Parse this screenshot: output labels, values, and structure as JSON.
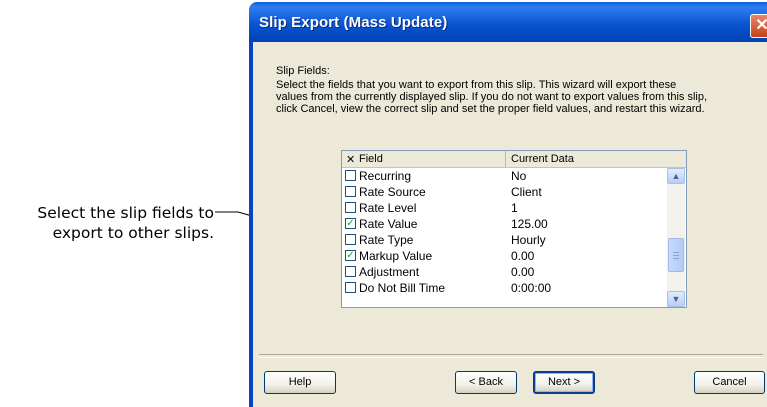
{
  "callout": {
    "line1": "Select the slip fields to",
    "line2": "export to other slips."
  },
  "dialog": {
    "title": "Slip Export (Mass Update)",
    "close_glyph": "✕",
    "heading": "Slip Fields:",
    "description_lines": [
      "Select the fields that you want to export from this slip. This wizard will export these",
      "values from the currently displayed slip. If you do not want to export values from this slip,",
      "click Cancel, view the correct slip and set the proper field values, and restart this wizard."
    ]
  },
  "grid": {
    "columns": {
      "check": "✕",
      "field": "Field",
      "current": "Current Data"
    },
    "rows": [
      {
        "field": "Recurring",
        "value": "No",
        "checked": false
      },
      {
        "field": "Rate Source",
        "value": "Client",
        "checked": false
      },
      {
        "field": "Rate Level",
        "value": "1",
        "checked": false
      },
      {
        "field": "Rate Value",
        "value": "125.00",
        "checked": true
      },
      {
        "field": "Rate Type",
        "value": "Hourly",
        "checked": false
      },
      {
        "field": "Markup Value",
        "value": "0.00",
        "checked": true
      },
      {
        "field": "Adjustment",
        "value": "0.00",
        "checked": false
      },
      {
        "field": "Do Not Bill Time",
        "value": "0:00:00",
        "checked": false
      }
    ],
    "check_glyph": "✓",
    "scroll_up_glyph": "▲",
    "scroll_down_glyph": "▼"
  },
  "buttons": {
    "help": "Help",
    "back": "< Back",
    "next": "Next >",
    "cancel": "Cancel"
  },
  "colors": {
    "title_bar": "#0a55d0",
    "dialog_face": "#ece9d8",
    "close_button": "#d5522c"
  }
}
